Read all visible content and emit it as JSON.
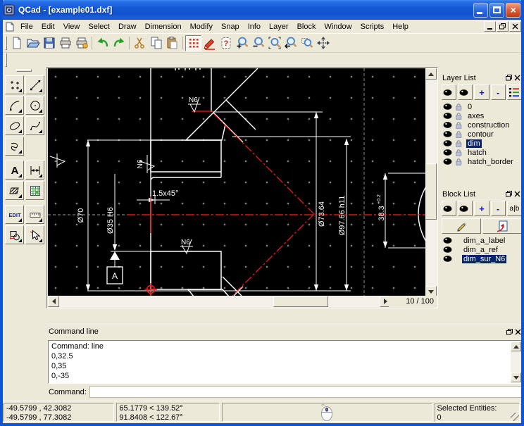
{
  "window": {
    "title": "QCad - [example01.dxf]"
  },
  "menu_bar": {
    "items": [
      "File",
      "Edit",
      "View",
      "Select",
      "Draw",
      "Dimension",
      "Modify",
      "Snap",
      "Info",
      "Layer",
      "Block",
      "Window",
      "Scripts",
      "Help"
    ]
  },
  "toolbar": {
    "icons": [
      "new-file",
      "open-file",
      "save",
      "print",
      "print-preview",
      "undo",
      "redo",
      "cut",
      "copy",
      "paste",
      "grid-toggle",
      "draft-mode",
      "redraw",
      "zoom-in",
      "zoom-out",
      "zoom-auto",
      "zoom-previous",
      "zoom-window",
      "pan"
    ]
  },
  "left_toolbar": {
    "tools": [
      "points",
      "lines",
      "arcs",
      "circles",
      "ellipses",
      "splines",
      "polylines",
      "text",
      "dimensions",
      "hatches",
      "images",
      "edit",
      "measure",
      "blocks",
      "select"
    ]
  },
  "icon_glyphs": {
    "redraw": "?",
    "text_tool": "A",
    "edit_tool": "EDIT",
    "rename": "a|b"
  },
  "canvas": {
    "zoom_indicator": "10 / 100",
    "labels": {
      "dia70": "Ø70",
      "dia35": "Ø35 H6",
      "chamfer": "1.5x45°",
      "dia7364": "Ø73.64",
      "dia9766": "Ø97.66 h11",
      "angle_value": "38.3",
      "angle_tolerance": "+0.2",
      "surface_finish": "N6",
      "datum": "A"
    }
  },
  "layer_list": {
    "title": "Layer List",
    "layers": [
      {
        "name": "0",
        "visible": true,
        "locked": true,
        "selected": false
      },
      {
        "name": "axes",
        "visible": true,
        "locked": true,
        "selected": false
      },
      {
        "name": "construction",
        "visible": false,
        "locked": true,
        "selected": false
      },
      {
        "name": "contour",
        "visible": true,
        "locked": true,
        "selected": false
      },
      {
        "name": "dim",
        "visible": true,
        "locked": true,
        "selected": true
      },
      {
        "name": "hatch",
        "visible": true,
        "locked": true,
        "selected": false
      },
      {
        "name": "hatch_border",
        "visible": true,
        "locked": true,
        "selected": false
      }
    ]
  },
  "block_list": {
    "title": "Block List",
    "blocks": [
      {
        "name": "dim_a_label",
        "visible": true,
        "selected": false
      },
      {
        "name": "dim_a_ref",
        "visible": true,
        "selected": false
      },
      {
        "name": "dim_sur_N6",
        "visible": true,
        "selected": true
      }
    ]
  },
  "list_toolbar": {
    "add": "+",
    "remove": "-"
  },
  "command_panel": {
    "title": "Command line",
    "history_lines": [
      "Command: line",
      "0,32.5",
      "0,35",
      "0,-35"
    ],
    "prompt_label": "Command:",
    "input_value": ""
  },
  "status_bar": {
    "absolute_coords_line1": "-49.5799 , 42.3082",
    "absolute_coords_line2": "-49.5799 , 77.3082",
    "relative_coords_line1": "65.1779 < 139.52°",
    "relative_coords_line2": "91.8408 < 122.67°",
    "selected_entities_label": "Selected Entities:",
    "selected_entities_count": "0"
  },
  "colors": {
    "titlebar_blue": "#1658d4",
    "canvas_bg": "#000000",
    "hatch_green": "#22cc22",
    "centerline_red": "#ff1a1a",
    "outline_white": "#ffffff",
    "selection_blue": "#0a246a",
    "face": "#ece9d8"
  }
}
